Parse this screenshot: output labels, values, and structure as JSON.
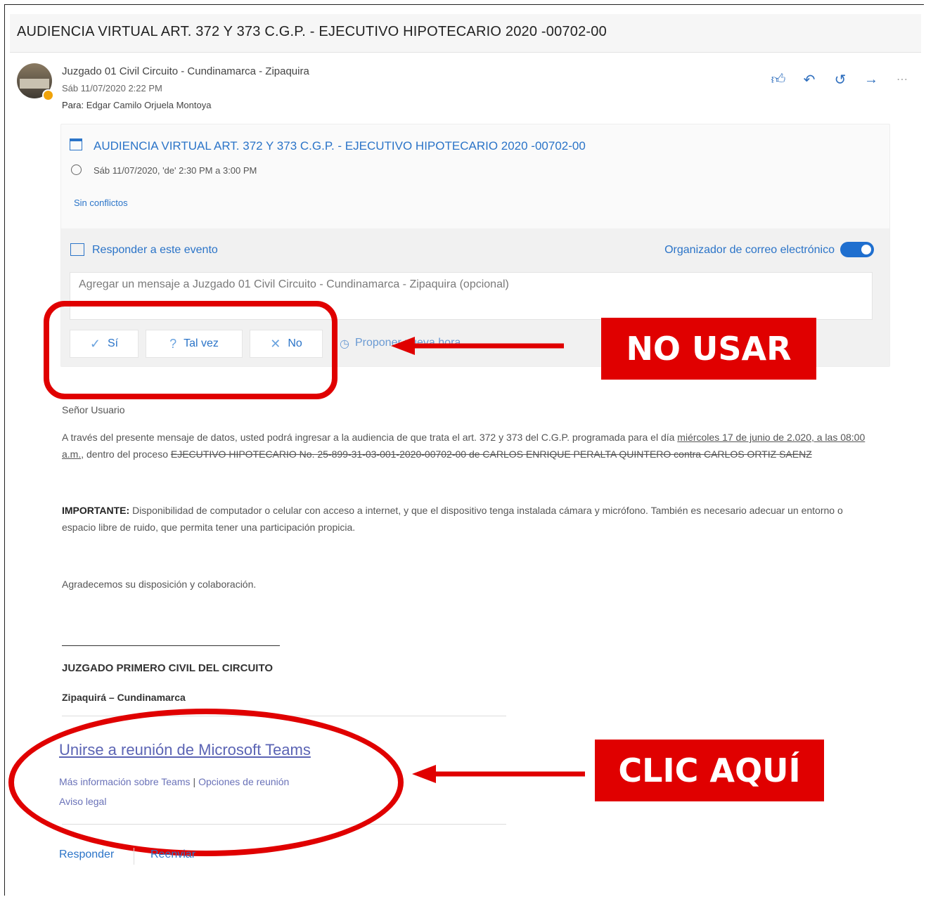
{
  "email": {
    "subject": "AUDIENCIA VIRTUAL ART. 372 Y 373 C.G.P. - EJECUTIVO HIPOTECARIO 2020 -00702-00",
    "sender": "Juzgado 01 Civil Circuito - Cundinamarca - Zipaquira",
    "sent_date": "Sáb 11/07/2020 2:22 PM",
    "to_label": "Para:",
    "to_name": "Edgar Camilo Orjuela Montoya",
    "actions": [
      "like-icon",
      "reply-icon",
      "reply-all-icon",
      "forward-icon",
      "more-icon"
    ]
  },
  "event": {
    "title": "AUDIENCIA VIRTUAL ART. 372 Y 373 C.G.P. - EJECUTIVO HIPOTECARIO 2020 -00702-00",
    "time": "Sáb 11/07/2020, 'de' 2:30 PM a 3:00 PM",
    "conflicts": "Sin conflictos",
    "respond_label": "Responder a este evento",
    "organizer_label": "Organizador de correo electrónico",
    "organizer_toggle": true,
    "message_placeholder": "Agregar un mensaje a Juzgado 01 Civil Circuito - Cundinamarca - Zipaquira (opcional)",
    "buttons": {
      "yes": "Sí",
      "maybe": "Tal vez",
      "no": "No",
      "propose": "Proponer nueva hora"
    }
  },
  "annotations": {
    "no_usar": "NO USAR",
    "clic_aqui": "CLIC AQUÍ",
    "color": "#e00000"
  },
  "body": {
    "greeting": "Señor Usuario",
    "para1_a": "A través del presente mensaje de datos, usted podrá ingresar a la audiencia de que trata el art. 372 y 373 del C.G.P. programada para el día ",
    "para1_u": "miércoles 17 de junio de 2.020, a las 08:00 a.m.",
    "para1_b": ", dentro del proceso ",
    "para1_s": "EJECUTIVO HIPOTECARIO No. 25-899-31-03-001-2020-00702-00 de CARLOS ENRIQUE PERALTA QUINTERO contra CARLOS ORTIZ SAENZ",
    "para2_bold": "IMPORTANTE:",
    "para2": " Disponibilidad de computador o celular con acceso a internet, y que el dispositivo tenga instalada cámara y micrófono. También es necesario adecuar un entorno o espacio libre de ruido, que permita tener una participación propicia.",
    "para3": "Agradecemos su disposición y colaboración.",
    "sig_name": "JUZGADO PRIMERO CIVIL DEL CIRCUITO",
    "sig_city": "Zipaquirá – Cundinamarca"
  },
  "teams": {
    "join_link": "Unirse a reunión de Microsoft Teams",
    "more_info": "Más información sobre Teams",
    "sep": "|",
    "options": "Opciones de reunión",
    "legal": "Aviso legal"
  },
  "footer": {
    "reply": "Responder",
    "forward": "Reenviar"
  }
}
